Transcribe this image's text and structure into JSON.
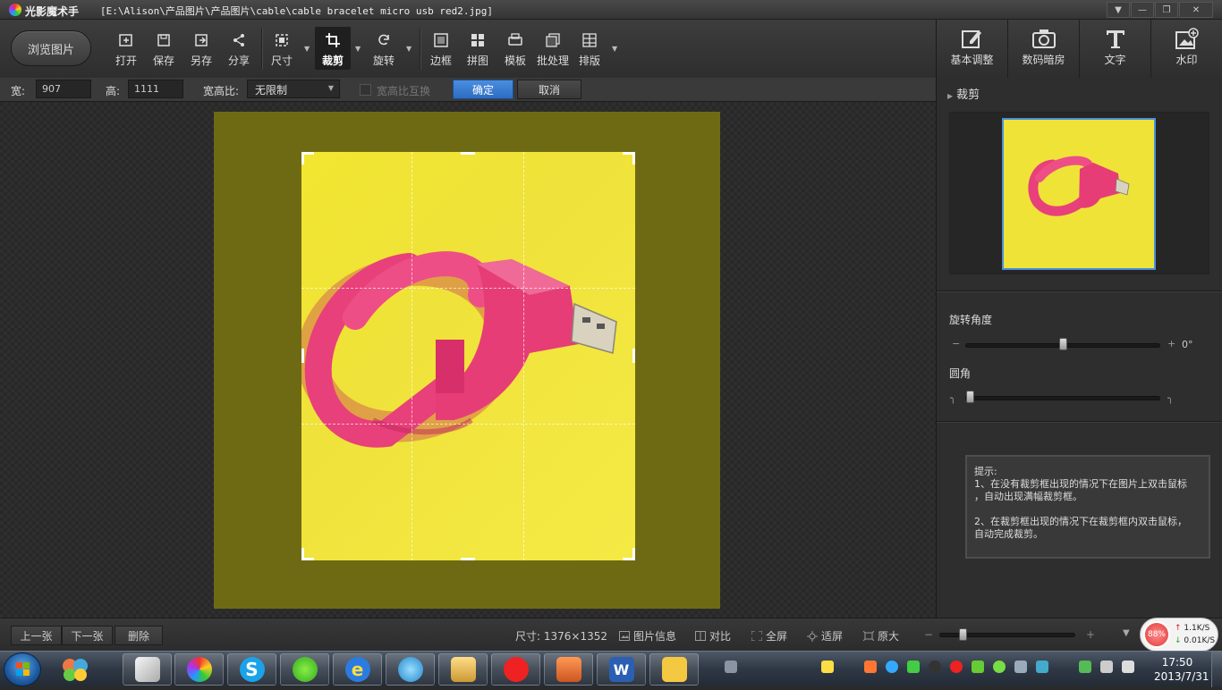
{
  "window": {
    "app_title": "光影魔术手",
    "file_path": "[E:\\Alison\\产品图片\\产品图片\\cable\\cable bracelet micro usb red2.jpg]",
    "buttons": {
      "menu": "▼",
      "minimize": "—",
      "maximize": "❐",
      "close": "✕"
    }
  },
  "toolbar": {
    "browse": "浏览图片",
    "tools": [
      "打开",
      "保存",
      "另存",
      "分享",
      "尺寸",
      "裁剪",
      "旋转",
      "边框",
      "拼图",
      "模板",
      "批处理",
      "排版"
    ],
    "active_tool": "裁剪"
  },
  "right_toolbar": {
    "tabs": [
      "基本调整",
      "数码暗房",
      "文字",
      "水印"
    ]
  },
  "crop_options": {
    "width_label": "宽:",
    "width_value": "907",
    "height_label": "高:",
    "height_value": "1111",
    "ratio_label": "宽高比:",
    "ratio_value": "无限制",
    "swap_label": "宽高比互换",
    "confirm": "确定",
    "cancel": "取消"
  },
  "right_panel": {
    "section_title": "裁剪",
    "rotate_label": "旋转角度",
    "rotate_minus": "−",
    "rotate_plus": "+",
    "rotate_value": "0°",
    "rotate_level": 0.5,
    "corner_label": "圆角",
    "corner_level": 0,
    "tips": {
      "title": "提示:",
      "line1": "1、在没有裁剪框出现的情况下在图片上双击鼠标",
      "line2": "，自动出现满幅裁剪框。",
      "line3": "2、在裁剪框出现的情况下在裁剪框内双击鼠标，",
      "line4": "自动完成裁剪。"
    }
  },
  "bottom_bar": {
    "prev": "上一张",
    "next": "下一张",
    "delete": "删除",
    "size_text": "尺寸: 1376×1352",
    "info": "图片信息",
    "compare": "对比",
    "fullscreen": "全屏",
    "fit": "适屏",
    "original": "原大",
    "zoom_minus": "−",
    "zoom_plus": "+",
    "zoom_level": 0.15,
    "dropdown": "▼"
  },
  "net_monitor": {
    "percent": "88%",
    "up": "1.1K/S",
    "down": "0.01K/S"
  },
  "taskbar": {
    "time": "17:50",
    "date": "2013/7/31"
  },
  "colors": {
    "accent": "#2d6cc2",
    "photo_bg": "#f2e630",
    "bracelet": "#e8407a"
  }
}
